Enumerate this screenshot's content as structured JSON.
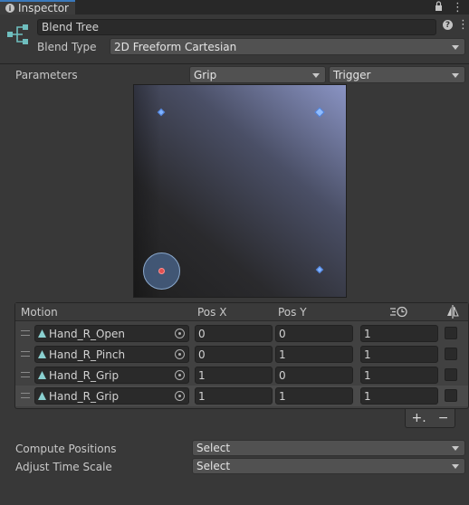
{
  "tab": {
    "title": "Inspector"
  },
  "header": {
    "name_value": "Blend Tree",
    "blend_type_label": "Blend Type",
    "blend_type_value": "2D Freeform Cartesian"
  },
  "parameters": {
    "label": "Parameters",
    "x_param": "Grip",
    "y_param": "Trigger"
  },
  "motion_table": {
    "headers": {
      "motion": "Motion",
      "pos_x": "Pos X",
      "pos_y": "Pos Y"
    },
    "rows": [
      {
        "motion": "Hand_R_Open",
        "pos_x": "0",
        "pos_y": "0",
        "speed": "1"
      },
      {
        "motion": "Hand_R_Pinch",
        "pos_x": "0",
        "pos_y": "1",
        "speed": "1"
      },
      {
        "motion": "Hand_R_Grip",
        "pos_x": "1",
        "pos_y": "0",
        "speed": "1"
      },
      {
        "motion": "Hand_R_Grip",
        "pos_x": "1",
        "pos_y": "1",
        "speed": "1"
      }
    ],
    "add_label": "+.",
    "remove_label": "−"
  },
  "settings": {
    "compute_positions_label": "Compute Positions",
    "compute_positions_value": "Select",
    "adjust_time_scale_label": "Adjust Time Scale",
    "adjust_time_scale_value": "Select"
  },
  "colors": {
    "accent": "#3a79bb",
    "point": "#7fb2ff",
    "current_point": "#e05050"
  },
  "icons": [
    "info-icon",
    "lock-icon",
    "menu-icon",
    "blend-tree-icon",
    "help-icon",
    "settings-icon",
    "time-icon",
    "mirror-icon",
    "animation-clip-icon",
    "object-picker-icon"
  ]
}
